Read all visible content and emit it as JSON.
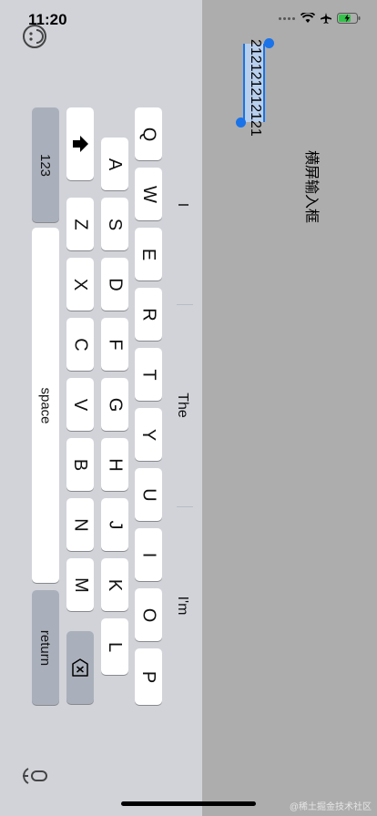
{
  "status_bar": {
    "time": "11:20"
  },
  "text_field": {
    "value": "212121212121",
    "label": "横屏输入框"
  },
  "suggestions": [
    "I",
    "The",
    "I'm"
  ],
  "keyboard": {
    "row1": [
      "Q",
      "W",
      "E",
      "R",
      "T",
      "Y",
      "U",
      "I",
      "O",
      "P"
    ],
    "row2": [
      "A",
      "S",
      "D",
      "F",
      "G",
      "H",
      "J",
      "K",
      "L"
    ],
    "row3": [
      "Z",
      "X",
      "C",
      "V",
      "B",
      "N",
      "M"
    ],
    "numbers_label": "123",
    "space_label": "space",
    "return_label": "return"
  },
  "watermark": "@稀土掘金技术社区"
}
